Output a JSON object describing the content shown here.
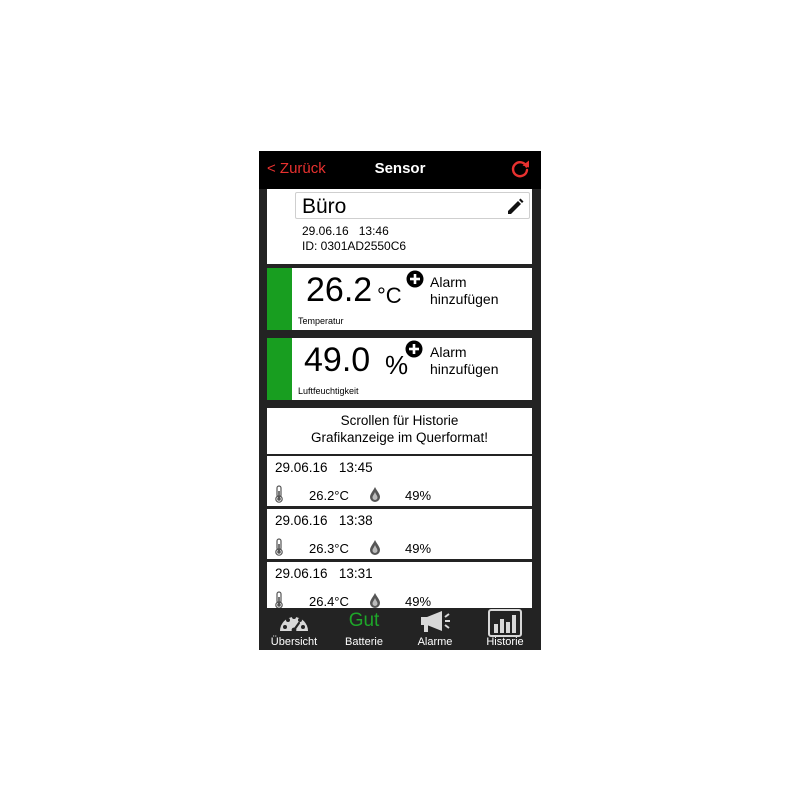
{
  "nav": {
    "back_label": "< Zurück",
    "title": "Sensor",
    "refresh_icon": "refresh-icon"
  },
  "sensor": {
    "name": "Büro",
    "date": "29.06.16",
    "time": "13:46",
    "id_line": "ID: 0301AD2550C6"
  },
  "temperature": {
    "value": "26.2",
    "unit": "°C",
    "alarm_line1": "Alarm",
    "alarm_line2": "hinzufügen",
    "label": "Temperatur",
    "status_color": "#189e20"
  },
  "humidity": {
    "value": "49.0",
    "unit": "%",
    "alarm_line1": "Alarm",
    "alarm_line2": "hinzufügen",
    "label": "Luftfeuchtigkeit",
    "status_color": "#189e20"
  },
  "scroll_hint": {
    "line1": "Scrollen für Historie",
    "line2": "Grafikanzeige im Querformat!"
  },
  "history": [
    {
      "date": "29.06.16",
      "time": "13:45",
      "temp": "26.2°C",
      "hum": "49%"
    },
    {
      "date": "29.06.16",
      "time": "13:38",
      "temp": "26.3°C",
      "hum": "49%"
    },
    {
      "date": "29.06.16",
      "time": "13:31",
      "temp": "26.4°C",
      "hum": "49%"
    }
  ],
  "tabs": {
    "overview": "Übersicht",
    "battery_status": "Gut",
    "battery": "Batterie",
    "alarms": "Alarme",
    "history": "Historie"
  },
  "colors": {
    "accent_red": "#e8312f",
    "good_green": "#1ea629"
  }
}
